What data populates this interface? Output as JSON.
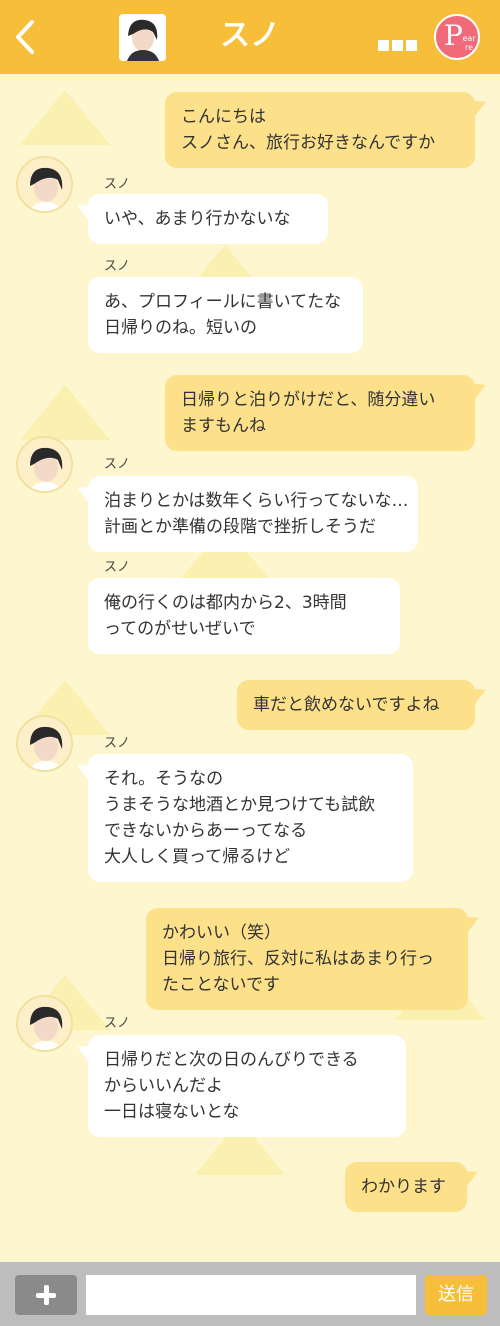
{
  "header": {
    "title": "スノ",
    "logo_letter": "P",
    "logo_sub": "ear re",
    "color": "#f7be3a"
  },
  "messages": [
    {
      "from": "me",
      "lines": [
        "こんにちは",
        "スノさん、旅行お好きなんですか"
      ]
    },
    {
      "from": "them",
      "sender": "スノ",
      "lines": [
        "いや、あまり行かないな"
      ]
    },
    {
      "from": "them",
      "sender": "スノ",
      "lines": [
        "あ、プロフィールに書いてたな",
        "日帰りのね。短いの"
      ]
    },
    {
      "from": "me",
      "lines": [
        "日帰りと泊りがけだと、随分違い",
        "ますもんね"
      ]
    },
    {
      "from": "them",
      "sender": "スノ",
      "lines": [
        "泊まりとかは数年くらい行ってないな…",
        "計画とか準備の段階で挫折しそうだ"
      ]
    },
    {
      "from": "them",
      "sender": "スノ",
      "lines": [
        "俺の行くのは都内から2、3時間",
        "ってのがせいぜいで"
      ]
    },
    {
      "from": "me",
      "lines": [
        "車だと飲めないですよね"
      ]
    },
    {
      "from": "them",
      "sender": "スノ",
      "lines": [
        "それ。そうなの",
        "うまそうな地酒とか見つけても試飲",
        "できないからあーってなる",
        "大人しく買って帰るけど"
      ]
    },
    {
      "from": "me",
      "lines": [
        "かわいい（笑）",
        "日帰り旅行、反対に私はあまり行っ",
        "たことないです"
      ]
    },
    {
      "from": "them",
      "sender": "スノ",
      "lines": [
        "日帰りだと次の日のんびりできる",
        "からいいんだよ",
        "一日は寝ないとな"
      ]
    },
    {
      "from": "me",
      "lines": [
        "わかります"
      ]
    }
  ],
  "footer": {
    "input_placeholder": "",
    "send_label": "送信"
  }
}
